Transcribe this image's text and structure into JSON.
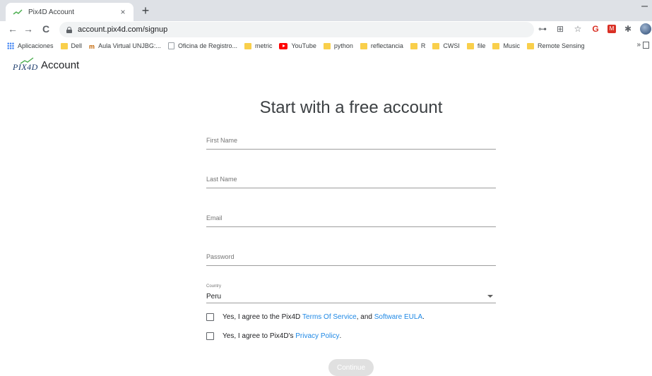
{
  "browser": {
    "tab_title": "Pix4D Account",
    "tab_close": "×",
    "new_tab": "+",
    "window_minimize": "–",
    "url": "account.pix4d.com/signup",
    "nav": {
      "back": "←",
      "forward": "→",
      "reload": "C"
    },
    "extensions": {
      "key": "⊶",
      "translate": "⊞",
      "star": "☆",
      "red_ext": "G",
      "red_ext_badge": "M",
      "puzzle": "✱"
    },
    "bookmarks": [
      {
        "label": "Aplicaciones",
        "icon": "apps-icon"
      },
      {
        "label": "Dell",
        "icon": "folder-icon"
      },
      {
        "label": "Aula Virtual UNJBG:...",
        "icon": "moodle-icon"
      },
      {
        "label": "Oficina de Registro...",
        "icon": "page-icon"
      },
      {
        "label": "metric",
        "icon": "folder-icon"
      },
      {
        "label": "YouTube",
        "icon": "youtube-icon"
      },
      {
        "label": "python",
        "icon": "folder-icon"
      },
      {
        "label": "reflectancia",
        "icon": "folder-icon"
      },
      {
        "label": "R",
        "icon": "folder-icon"
      },
      {
        "label": "CWSI",
        "icon": "folder-icon"
      },
      {
        "label": "file",
        "icon": "folder-icon"
      },
      {
        "label": "Music",
        "icon": "folder-icon"
      },
      {
        "label": "Remote Sensing",
        "icon": "folder-icon"
      }
    ],
    "bookmarks_more": "»",
    "moodle_glyph": "m"
  },
  "header": {
    "logo_text": "PIX4D",
    "title": "Account"
  },
  "form": {
    "title": "Start with a free account",
    "first_name_placeholder": "First Name",
    "last_name_placeholder": "Last Name",
    "email_placeholder": "Email",
    "password_placeholder": "Password",
    "country_label": "Country",
    "country_value": "Peru",
    "tos_text_1": "Yes, I agree to the Pix4D ",
    "tos_link_1": "Terms Of Service",
    "tos_text_2": ", and ",
    "tos_link_2": "Software EULA",
    "tos_text_3": ".",
    "privacy_text_1": "Yes, I agree to Pix4D's ",
    "privacy_link": "Privacy Policy",
    "privacy_text_2": ".",
    "continue_label": "Continue"
  },
  "colors": {
    "link": "#1e88e5",
    "button_disabled": "#e0e0e0",
    "logo": "#1a3a6b"
  }
}
